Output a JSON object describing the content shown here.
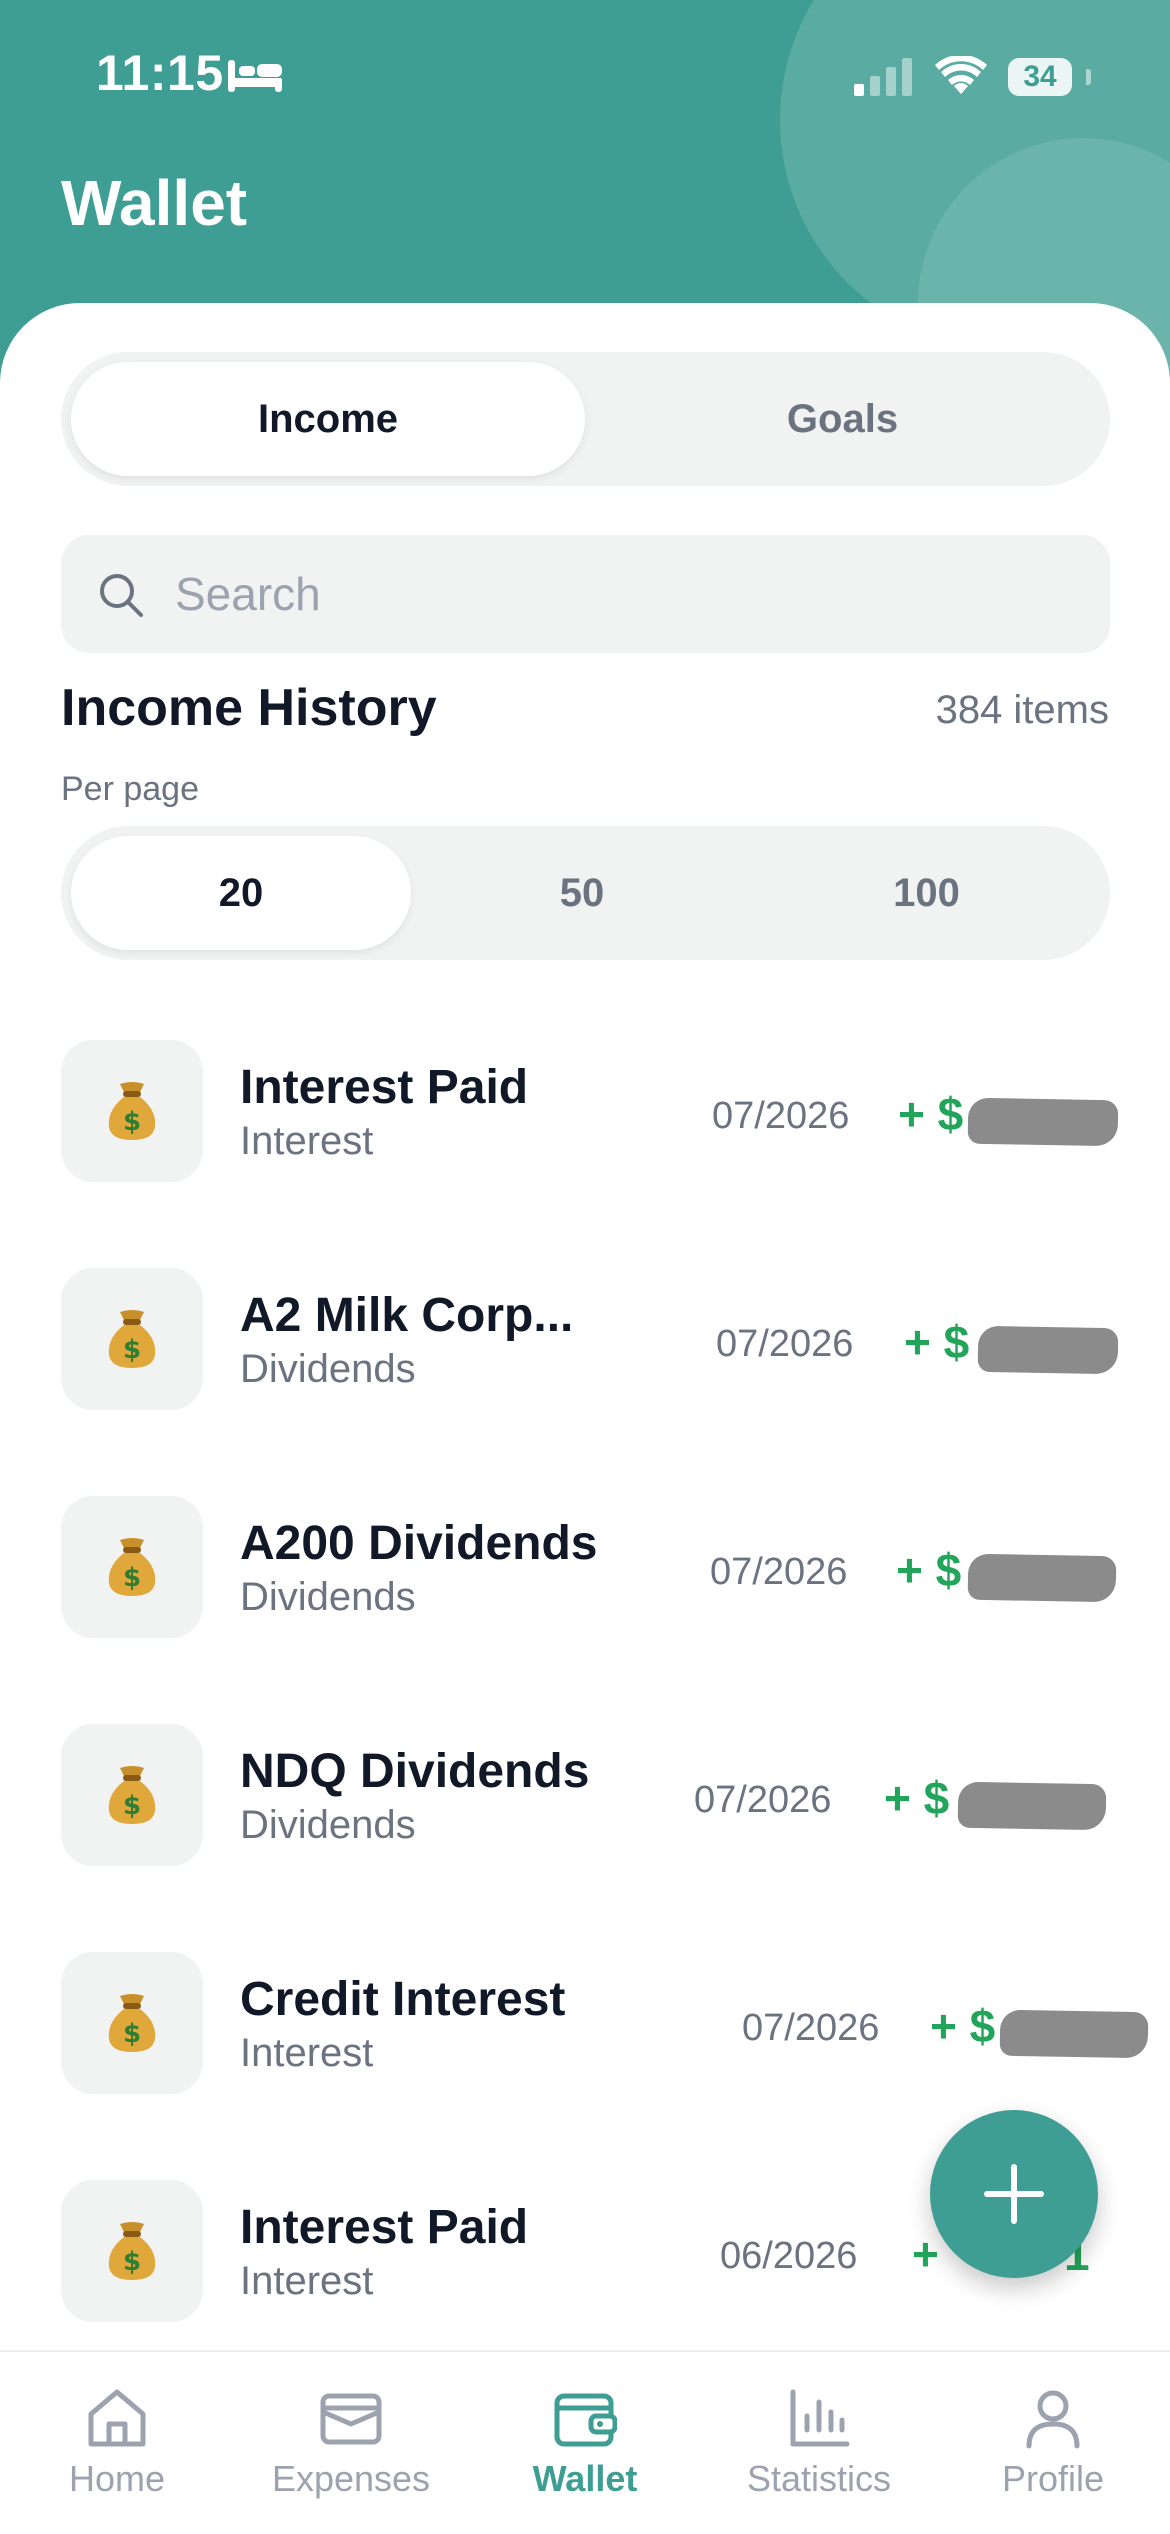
{
  "status": {
    "time": "11:15",
    "battery": "34"
  },
  "header": {
    "title": "Wallet"
  },
  "tabs": {
    "income": "Income",
    "goals": "Goals",
    "active": "income"
  },
  "search": {
    "placeholder": "Search"
  },
  "history": {
    "title": "Income History",
    "count": "384 items",
    "per_page_label": "Per page"
  },
  "per_page": {
    "options": [
      "20",
      "50",
      "100"
    ],
    "selected": "20"
  },
  "items": [
    {
      "title": "Interest Paid",
      "category": "Interest",
      "date": "07/2026",
      "amount": "+ $",
      "icon": "money-bag-icon"
    },
    {
      "title": "A2 Milk Corp...",
      "category": "Dividends",
      "date": "07/2026",
      "amount": "+ $",
      "icon": "money-bag-icon"
    },
    {
      "title": "A200 Dividends",
      "category": "Dividends",
      "date": "07/2026",
      "amount": "+ $",
      "icon": "money-bag-icon"
    },
    {
      "title": "NDQ Dividends",
      "category": "Dividends",
      "date": "07/2026",
      "amount": "+ $",
      "icon": "money-bag-icon"
    },
    {
      "title": "Credit Interest",
      "category": "Interest",
      "date": "07/2026",
      "amount": "+ $",
      "icon": "money-bag-icon"
    },
    {
      "title": "Interest Paid",
      "category": "Interest",
      "date": "06/2026",
      "amount": "+",
      "amount_tail": "1",
      "icon": "money-bag-icon"
    }
  ],
  "bottom_nav": {
    "items": [
      {
        "label": "Home",
        "icon": "home-icon"
      },
      {
        "label": "Expenses",
        "icon": "wallet-card-icon"
      },
      {
        "label": "Wallet",
        "icon": "wallet-icon"
      },
      {
        "label": "Statistics",
        "icon": "bar-chart-icon"
      },
      {
        "label": "Profile",
        "icon": "profile-icon"
      }
    ],
    "active": "Wallet"
  },
  "colors": {
    "accent": "#3f9e93",
    "income_green": "#22a55a",
    "surface": "#f1f3f2"
  }
}
